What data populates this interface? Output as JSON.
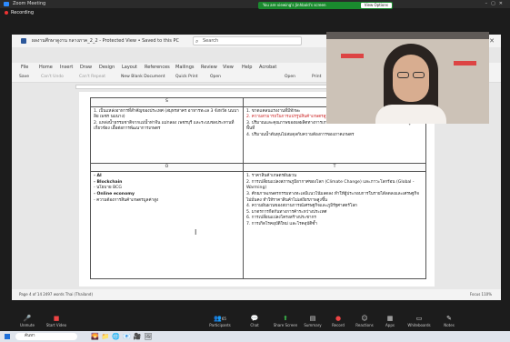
{
  "zoom": {
    "title": "Zoom Meeting",
    "recording": "Recording",
    "share_notice": "You are viewing's Jinhbald's screen",
    "view_options": "View Options"
  },
  "word": {
    "doc_title": "ผลงานศึกษาดูงาน กลางภาค_2_2 - Protected View • Saved to this PC",
    "search_placeholder": "Search",
    "menu": [
      "File",
      "Home",
      "Insert",
      "Draw",
      "Design",
      "Layout",
      "References",
      "Mailings",
      "Review",
      "View",
      "Help",
      "Acrobat"
    ],
    "toolbar": [
      "Save",
      "Can't Undo",
      "Can't Repeat",
      "New Blank Document",
      "Quick Print",
      "Open",
      "Open",
      "Print"
    ],
    "table": {
      "headers_top": [
        "S",
        "W"
      ],
      "s_items": [
        "1. เป็นแหล่งอาหารที่สำคัญของประเทศ (สมุทรสาคร อาหารทะเล 3 จังหวัด นนบาลิย เพชร นมนาง)",
        "2. แหล่งน้ำธรรมชาติจากแม่น้ำท่าจีน แม่กลอง เพชรบุรี และระบบชลประทานที่เกี่ยวข้อง เอื้อต่อการพัฒนาการเกษตร"
      ],
      "w_items": [
        "1. ขาดแคลนแรงงานที่มีทักษะ",
        "2. ความสามารถในการแปรรูปสินค้าเกษตรสูงสุด ยังคงนะตัวเดิก ????",
        "3. ปริมาณและคุณภาพของผลผลิตทางการเกษตรไม่คงที่ และความต้องการของโรงงานแปรรูปในพื้นที่",
        "4. ปริมาณน้ำต้นทุนไม่สมดุลกับความต้องการของภาคเกษตร"
      ],
      "headers_bottom": [
        "O",
        "T"
      ],
      "o_items": [
        "- AI",
        "- Blockchain",
        "- นโยบาย BCG",
        "- Online economy",
        "- ความต้องการสินค้าเกษตรมูลค่าสูง"
      ],
      "t_items": [
        "1. ราคาสินค้าเกษตรผันผวน",
        "2. การเปลี่ยนแปลงสภาพภูมิอากาศของโลก (Climate Change) และภาวะโลกร้อน (Global - Warming)",
        "3. ศักยภาพเกษตรกรรมทางทะเลมีแนวโน้มลดลง ทำให้ผู้ประกอบการในรายได้ลดลงและเศรษฐกิจไม่มั่นคง ทำให้ราคาสินค้าไม่เสถียรภาพสูงขึ้น",
        "4. ความผันผวนของสถานการณ์เศรษฐกิจและภูมิรัฐศาสตร์โลก",
        "5. มาตรการกีดกันทางการค้าระหว่างประเทศ",
        "6. การเปลี่ยนแปลงโครงสร้างประชากร",
        "7. การเกิดโรคอุบัติใหม่ และโรคอุบัติซ้ำ"
      ]
    },
    "status_left": "Page 4 of 14   2497 words   Thai (Thailand)",
    "status_right": "Focus   110%"
  },
  "toolbar": {
    "items": [
      "Unmute",
      "Start Video",
      "Participants",
      "Chat",
      "Share Screen",
      "Summary",
      "Record",
      "Reactions",
      "Apps",
      "Whiteboards",
      "Notes"
    ],
    "participants_count": "65"
  },
  "taskbar": {
    "search": "ค้นหา"
  }
}
